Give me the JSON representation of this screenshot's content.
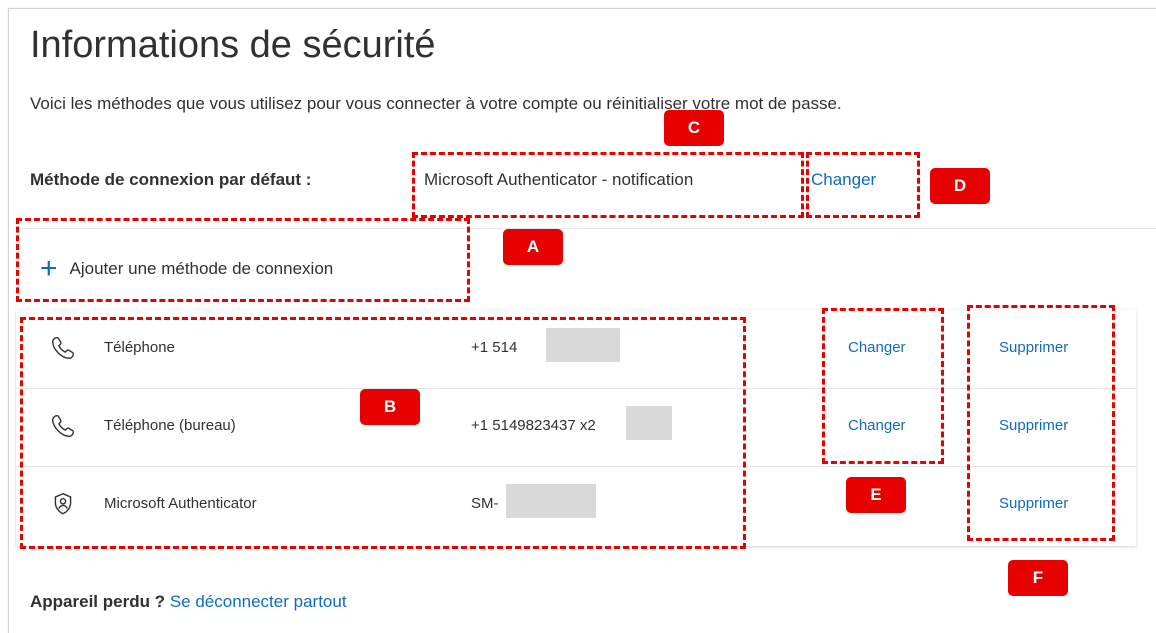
{
  "page": {
    "title": "Informations de sécurité",
    "subtitle": "Voici les méthodes que vous utilisez pour vous connecter à votre compte ou réinitialiser votre mot de passe.",
    "default_method_label": "Méthode de connexion par défaut :",
    "default_method_value": "Microsoft Authenticator - notification",
    "default_method_change": "Changer"
  },
  "add_method": {
    "label": "Ajouter une méthode de connexion",
    "icon": "plus-icon"
  },
  "methods": [
    {
      "icon": "phone-icon",
      "name": "Téléphone",
      "value": "+1 514",
      "change": "Changer",
      "delete": "Supprimer"
    },
    {
      "icon": "phone-icon",
      "name": "Téléphone (bureau)",
      "value": "+1 5149823437 x2",
      "change": "Changer",
      "delete": "Supprimer"
    },
    {
      "icon": "authenticator-icon",
      "name": "Microsoft Authenticator",
      "value": "SM-",
      "delete": "Supprimer"
    }
  ],
  "footer": {
    "lost_label": "Appareil perdu ?",
    "signout_link": "Se déconnecter partout"
  },
  "annotations": {
    "A": "A",
    "B": "B",
    "C": "C",
    "D": "D",
    "E": "E",
    "F": "F"
  },
  "colors": {
    "link": "#0f6cbd",
    "annotation": "#e60000",
    "mask": "#d9d9d9"
  }
}
